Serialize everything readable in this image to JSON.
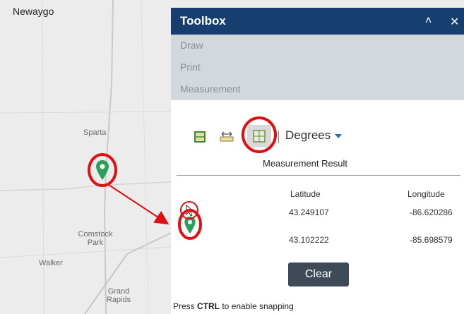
{
  "map": {
    "label_top": "Newaygo",
    "places": [
      "Sparta",
      "Comstock Park",
      "Walker",
      "Grand Rapids"
    ]
  },
  "toolbox": {
    "title": "Toolbox",
    "tools": [
      "Draw",
      "Print",
      "Measurement"
    ],
    "unit_select": "Degrees",
    "toolbar_icons": [
      "area-tool-icon",
      "distance-tool-icon",
      "location-tool-icon"
    ],
    "result_title": "Measurement Result",
    "columns": [
      "Latitude",
      "Longitude"
    ],
    "rows": [
      {
        "latitude": "43.249107",
        "longitude": "-86.620286"
      },
      {
        "latitude": "43.102222",
        "longitude": "-85.698579"
      }
    ],
    "clear_label": "Clear",
    "snap_prefix": "Press ",
    "snap_key": "CTRL",
    "snap_suffix": " to enable snapping"
  },
  "colors": {
    "header": "#163f70",
    "tool_list": "#d3d8dc",
    "pin": "#2e9e5b",
    "annotation": "#e01010",
    "button": "#3f4a58"
  }
}
